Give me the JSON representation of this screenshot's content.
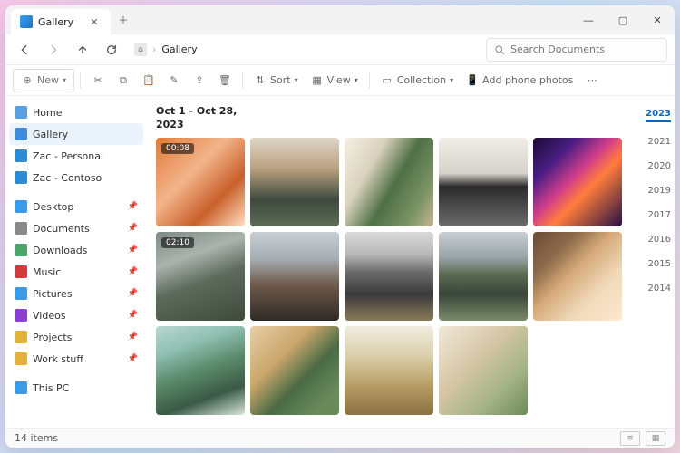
{
  "tab": {
    "title": "Gallery"
  },
  "breadcrumb": {
    "location": "Gallery"
  },
  "search": {
    "placeholder": "Search Documents"
  },
  "toolbar": {
    "new_label": "New",
    "sort_label": "Sort",
    "view_label": "View",
    "collection_label": "Collection",
    "phone_label": "Add phone photos"
  },
  "sidebar": {
    "top": [
      {
        "label": "Home",
        "icon": "home",
        "color": "#5aa0e0"
      },
      {
        "label": "Gallery",
        "icon": "gallery",
        "color": "#3c8de0",
        "selected": true
      },
      {
        "label": "Zac - Personal",
        "icon": "cloud",
        "color": "#2a8ad6"
      },
      {
        "label": "Zac - Contoso",
        "icon": "cloud",
        "color": "#2a8ad6"
      }
    ],
    "pinned": [
      {
        "label": "Desktop",
        "color": "#3a9be8"
      },
      {
        "label": "Documents",
        "color": "#8a8a8a"
      },
      {
        "label": "Downloads",
        "color": "#4aa568"
      },
      {
        "label": "Music",
        "color": "#d13b3b"
      },
      {
        "label": "Pictures",
        "color": "#3a9be8"
      },
      {
        "label": "Videos",
        "color": "#8a3fd1"
      },
      {
        "label": "Projects",
        "color": "#e4b23a"
      },
      {
        "label": "Work stuff",
        "color": "#e4b23a"
      }
    ],
    "system": [
      {
        "label": "This PC",
        "color": "#3a9be8"
      }
    ]
  },
  "gallery": {
    "range": "Oct 1 - Oct 28,",
    "year": "2023",
    "items": [
      {
        "badge": "00:08",
        "bg": "linear-gradient(135deg,#e07b3a 0%,#f3b48a 40%,#c9602a 70%,#ffe1c4 100%)"
      },
      {
        "bg": "linear-gradient(180deg,#e0d6c9 0%,#b9a07e 35%,#3e4a3e 70%,#5c6b57 100%)"
      },
      {
        "bg": "linear-gradient(120deg,#f5f0e4 0%,#d9d2bd 30%,#4e7045 55%,#7a9364 80%,#c9b694 100%)"
      },
      {
        "bg": "linear-gradient(180deg,#f0ede6 0%,#d6d3cb 40%,#2b2b2b 55%,#6b6b6b 100%)"
      },
      {
        "bg": "linear-gradient(135deg,#1a0a33 0%,#4a1e82 25%,#d13d8a 45%,#ff7d3a 60%,#241046 100%)"
      },
      {
        "badge": "02:10",
        "bg": "linear-gradient(160deg,#7e8a86 0%,#aab3ae 30%,#5e6b5c 55%,#3e4a3a 100%)"
      },
      {
        "bg": "linear-gradient(180deg,#c8cfd4 0%,#a6adb2 30%,#6d5a4a 60%,#2f2a26 100%)"
      },
      {
        "bg": "linear-gradient(180deg,#d9d9d9 0%,#b8b8b8 25%,#6c6c6c 45%,#3a3a3a 70%,#8a7a5a 100%)"
      },
      {
        "bg": "linear-gradient(180deg,#c9cfd3 0%,#9aa5a9 28%,#5b6a52 48%,#3a463a 70%,#7a8a6a 100%)"
      },
      {
        "bg": "linear-gradient(135deg,#6a4a34 0%,#8d6a4a 25%,#d6a97a 45%,#f0d9b8 70%,#ffe9d0 100%)"
      },
      {
        "bg": "linear-gradient(160deg,#b9d7d0 0%,#8fc0b2 25%,#5a8a6a 50%,#3a5a46 75%,#d9e6da 100%)"
      },
      {
        "bg": "linear-gradient(135deg,#e8cfa8 0%,#c9a66a 35%,#4a6a46 60%,#6a8a5a 85%)"
      },
      {
        "bg": "linear-gradient(180deg,#f0ece0 0%,#d9cda8 35%,#b8a06a 65%,#8a7042 100%)"
      },
      {
        "bg": "linear-gradient(135deg,#f0e8d8 0%,#d6c6a6 40%,#a6b48a 70%,#6a8a5a 100%)"
      }
    ]
  },
  "timeline": {
    "years": [
      "2023",
      "2021",
      "2020",
      "2019",
      "2017",
      "2016",
      "2015",
      "2014"
    ],
    "active": "2023"
  },
  "status": {
    "count": "14 items"
  }
}
